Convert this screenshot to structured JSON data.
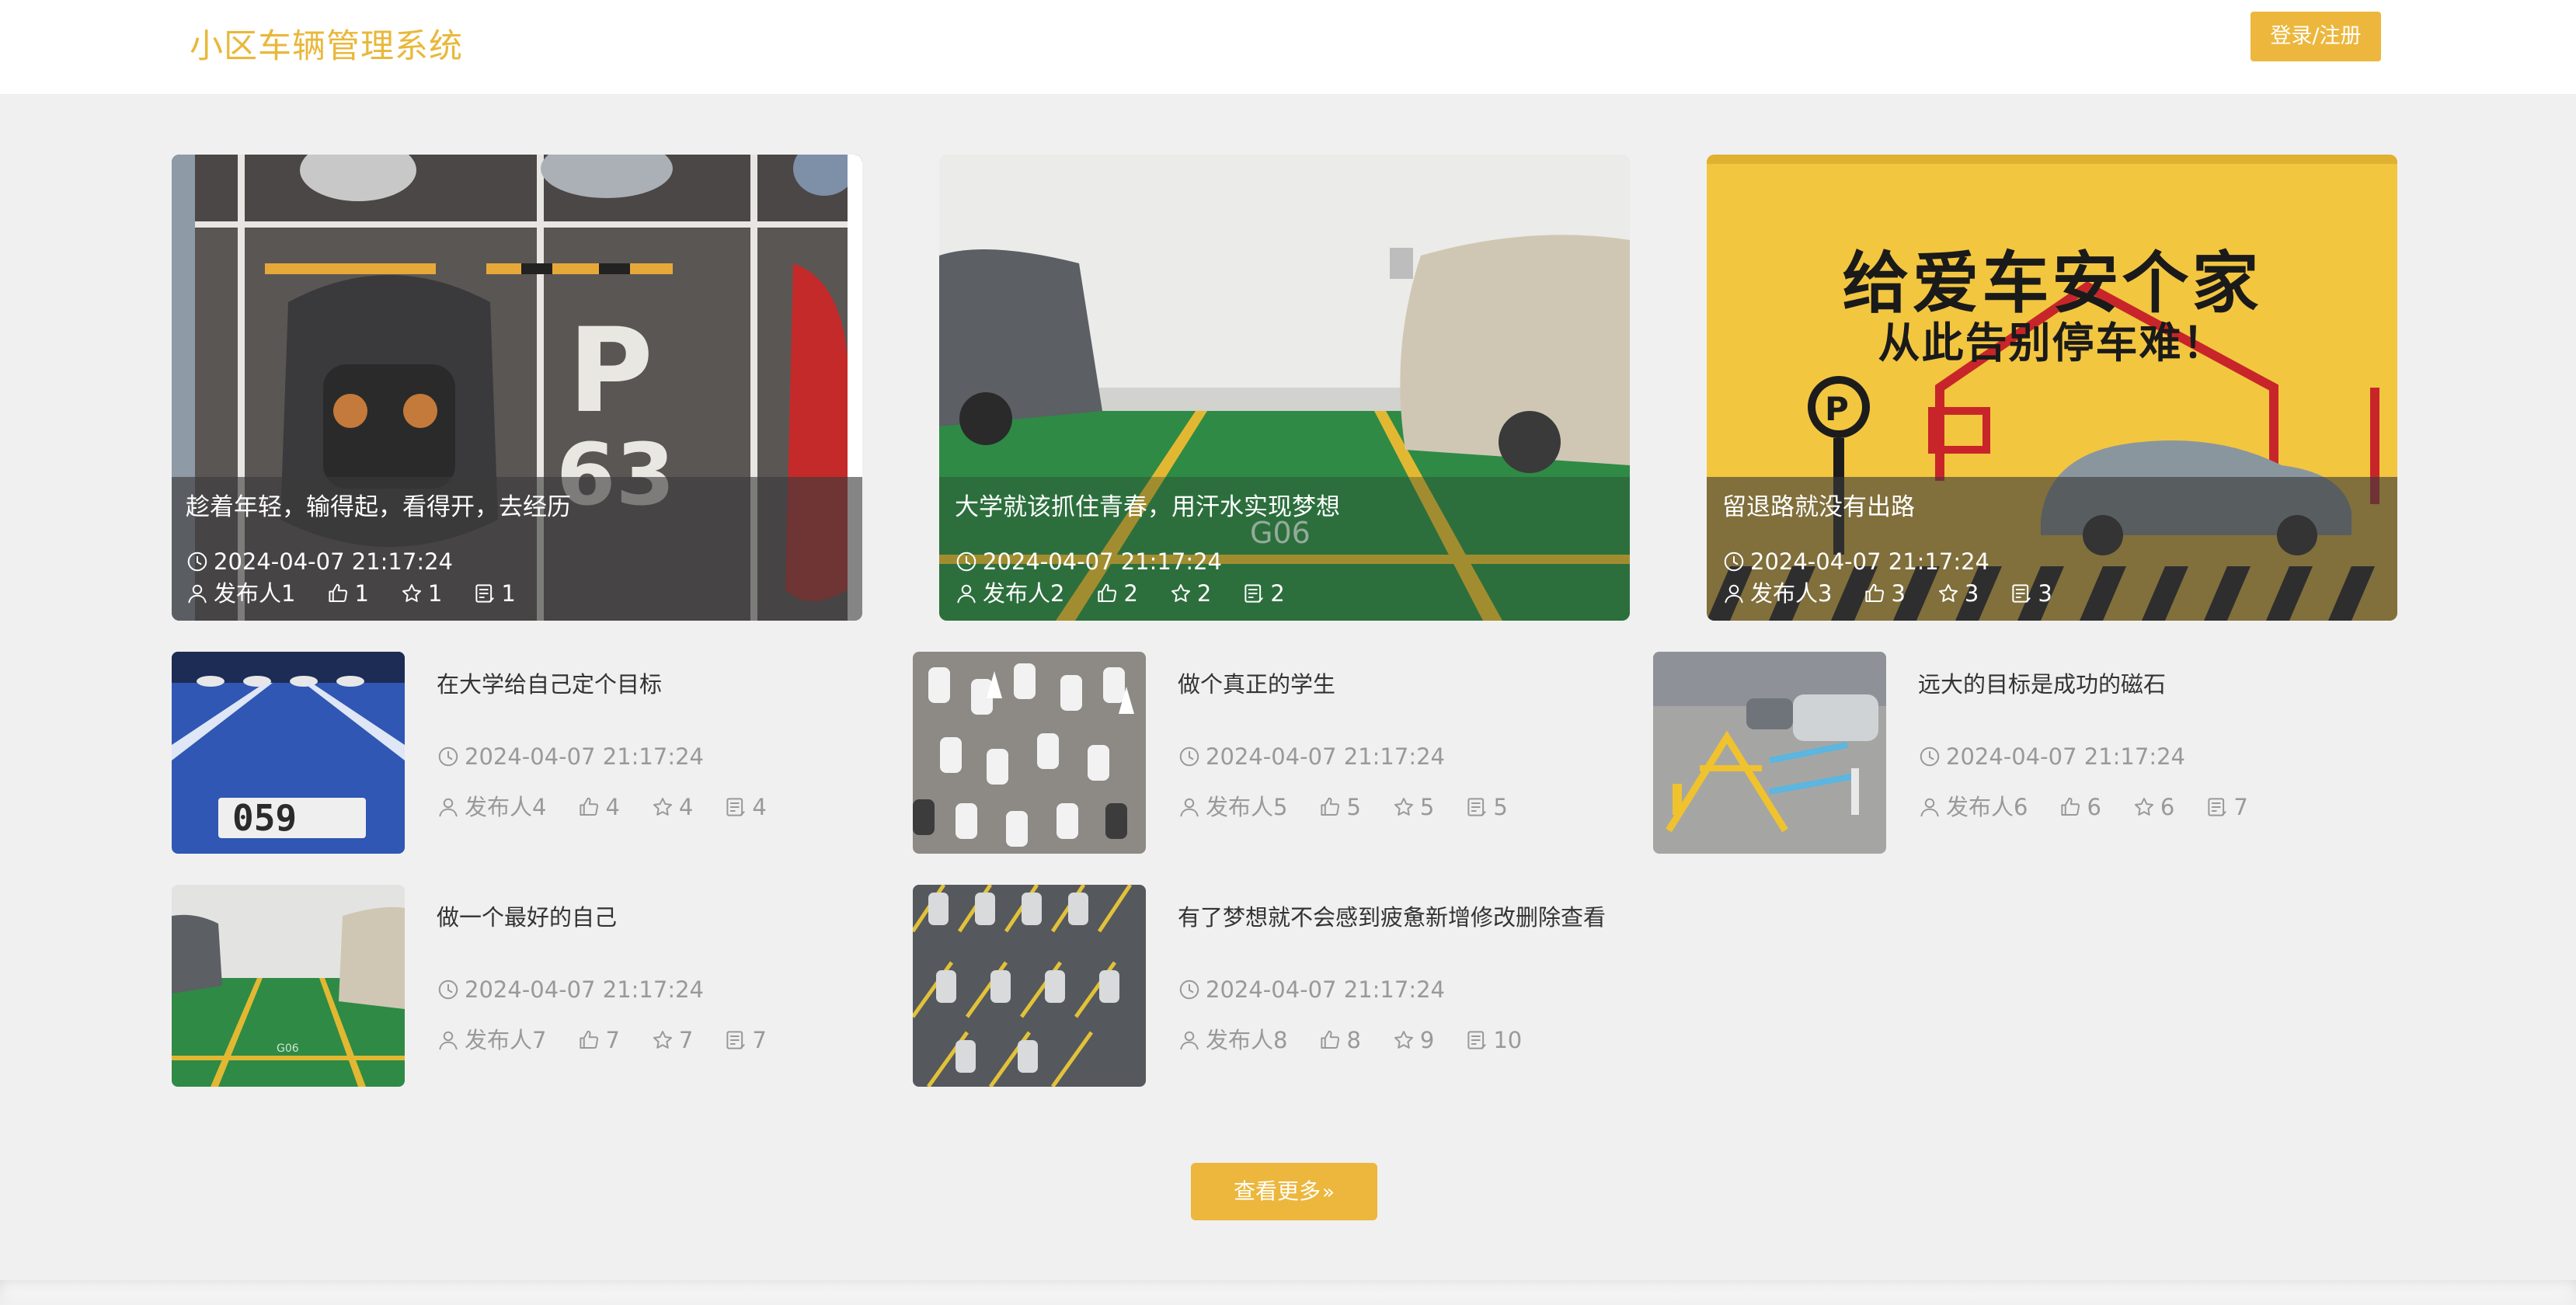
{
  "header": {
    "brand": "小区车辆管理系统",
    "login_label": "登录/注册"
  },
  "featured": [
    {
      "title": "趁着年轻，输得起，看得开，去经历",
      "date": "2024-04-07 21:17:24",
      "author": "发布人1",
      "likes": "1",
      "favorites": "1",
      "comments": "1"
    },
    {
      "title": "大学就该抓住青春，用汗水实现梦想",
      "date": "2024-04-07 21:17:24",
      "author": "发布人2",
      "likes": "2",
      "favorites": "2",
      "comments": "2"
    },
    {
      "title": "留退路就没有出路",
      "date": "2024-04-07 21:17:24",
      "author": "发布人3",
      "likes": "3",
      "favorites": "3",
      "comments": "3",
      "poster_line1": "给爱车安个家",
      "poster_line2": "从此告别停车难！"
    }
  ],
  "items": [
    {
      "title": "在大学给自己定个目标",
      "date": "2024-04-07 21:17:24",
      "author": "发布人4",
      "likes": "4",
      "favorites": "4",
      "comments": "4"
    },
    {
      "title": "做个真正的学生",
      "date": "2024-04-07 21:17:24",
      "author": "发布人5",
      "likes": "5",
      "favorites": "5",
      "comments": "5"
    },
    {
      "title": "远大的目标是成功的磁石",
      "date": "2024-04-07 21:17:24",
      "author": "发布人6",
      "likes": "6",
      "favorites": "6",
      "comments": "7"
    },
    {
      "title": "做一个最好的自己",
      "date": "2024-04-07 21:17:24",
      "author": "发布人7",
      "likes": "7",
      "favorites": "7",
      "comments": "7"
    },
    {
      "title": "有了梦想就不会感到疲惫新增修改删除查看",
      "date": "2024-04-07 21:17:24",
      "author": "发布人8",
      "likes": "8",
      "favorites": "9",
      "comments": "10"
    }
  ],
  "more": {
    "label": "查看更多",
    "chevron": "»"
  },
  "icons": [
    "clock-icon",
    "user-icon",
    "thumbs-up-icon",
    "star-icon",
    "comment-icon"
  ],
  "colors": {
    "accent": "#ecb73c",
    "brand": "#e9b83a",
    "muted": "#999999"
  }
}
